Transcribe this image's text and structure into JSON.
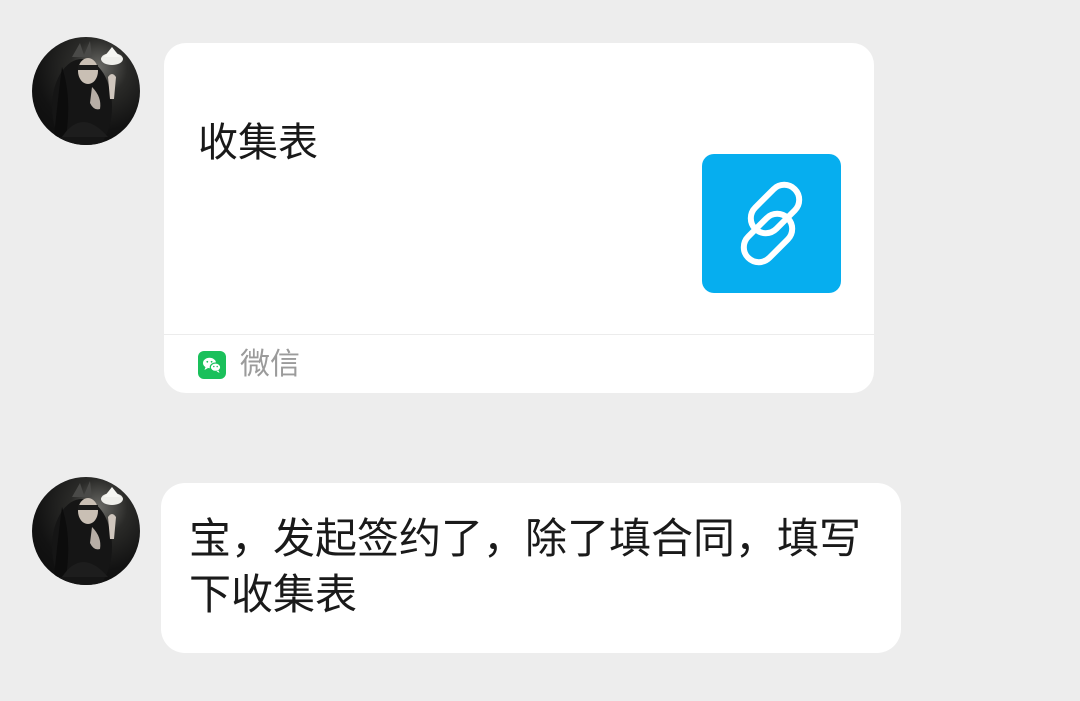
{
  "messages": [
    {
      "type": "link_card",
      "sender_avatar": "avatar",
      "title": "收集表",
      "thumbnail_icon": "link-icon",
      "source": {
        "icon": "wechat-icon",
        "label": "微信"
      }
    },
    {
      "type": "text",
      "sender_avatar": "avatar",
      "text": "宝，发起签约了，除了填合同，填写下收集表"
    }
  ],
  "colors": {
    "background": "#ededed",
    "bubble": "#ffffff",
    "link_thumbnail": "#06aeef",
    "wechat_green": "#1ac05b",
    "source_text": "#9b9b9b"
  }
}
